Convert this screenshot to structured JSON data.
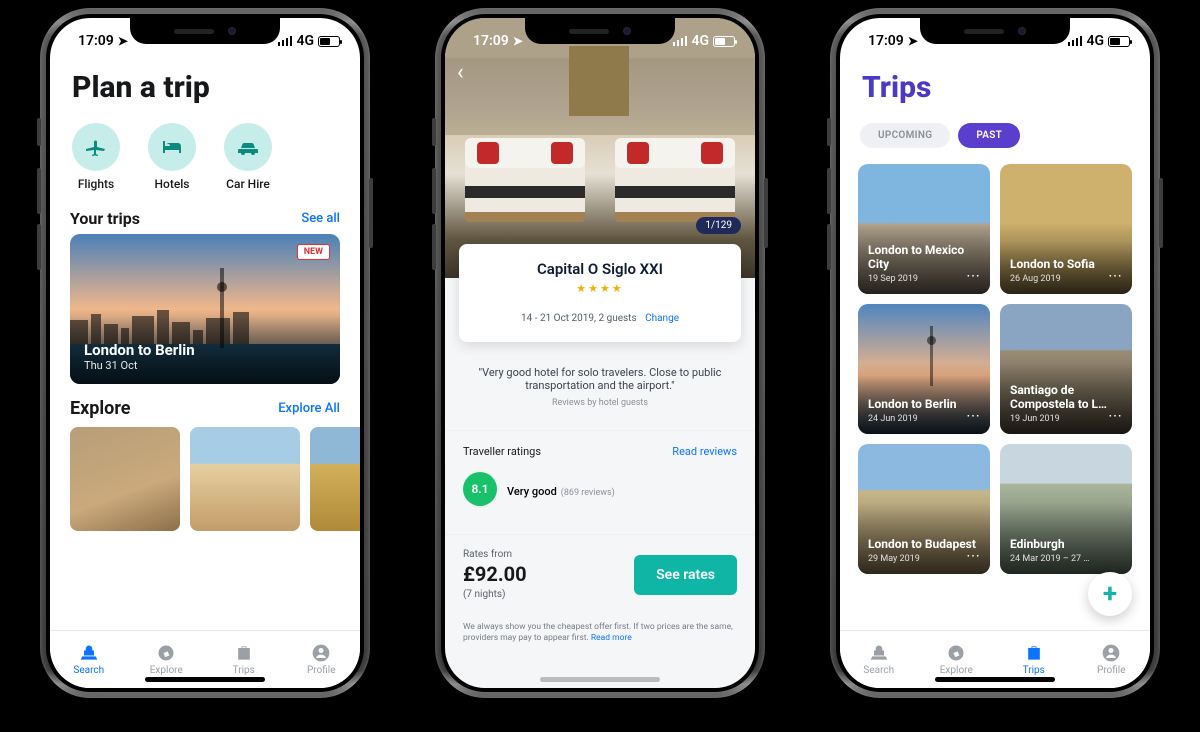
{
  "common": {
    "status": {
      "time": "17:09",
      "network": "4G"
    },
    "tabs": {
      "search": "Search",
      "explore": "Explore",
      "trips": "Trips",
      "profile": "Profile"
    }
  },
  "screen1": {
    "title": "Plan a trip",
    "categories": {
      "flights": "Flights",
      "hotels": "Hotels",
      "carhire": "Car Hire"
    },
    "your_trips": {
      "heading": "Your trips",
      "see_all": "See all",
      "card": {
        "badge": "NEW",
        "title": "London to Berlin",
        "date": "Thu 31 Oct"
      }
    },
    "explore": {
      "heading": "Explore",
      "explore_all": "Explore All"
    }
  },
  "screen2": {
    "photo_count": "1/129",
    "hotel_name": "Capital O Siglo XXI",
    "stars_display": "★★★★",
    "dates": "14 - 21 Oct 2019, 2 guests",
    "change_label": "Change",
    "review_quote": "\"Very good hotel for solo travelers. Close to public transportation and the airport.\"",
    "review_by": "Reviews by hotel guests",
    "ratings": {
      "heading": "Traveller ratings",
      "read_reviews": "Read reviews",
      "score": "8.1",
      "label": "Very good",
      "count": "(869 reviews)"
    },
    "rates": {
      "from": "Rates from",
      "price": "£92.00",
      "nights": "(7 nights)",
      "cta": "See rates"
    },
    "fine_print": "We always show you the cheapest offer first. If two prices are the same, providers may pay to appear first.",
    "read_more": "Read more"
  },
  "screen3": {
    "title": "Trips",
    "segments": {
      "upcoming": "UPCOMING",
      "past": "PAST"
    },
    "tiles": [
      {
        "title": "London to Mexico City",
        "date": "19 Sep 2019"
      },
      {
        "title": "London to Sofia",
        "date": "26 Aug 2019"
      },
      {
        "title": "London to Berlin",
        "date": "24 Jun 2019"
      },
      {
        "title": "Santiago de Compostela to L…",
        "date": "19 Jun 2019"
      },
      {
        "title": "London to Budapest",
        "date": "29 May 2019"
      },
      {
        "title": "Edinburgh",
        "date": "24 Mar 2019 – 27 …"
      }
    ],
    "fab": "+"
  }
}
